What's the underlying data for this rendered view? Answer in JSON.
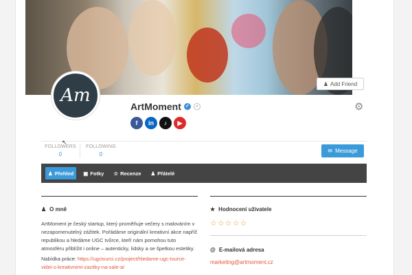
{
  "cover": {
    "add_friend_label": "Add Friend"
  },
  "profile": {
    "avatar_text": "Am",
    "name": "ArtMoment",
    "socials": [
      {
        "name": "facebook",
        "glyph": "f",
        "color": "#3b5998"
      },
      {
        "name": "linkedin",
        "glyph": "in",
        "color": "#0a66c2"
      },
      {
        "name": "tiktok",
        "glyph": "♪",
        "color": "#111111"
      },
      {
        "name": "youtube",
        "glyph": "▶",
        "color": "#e02a2a"
      }
    ]
  },
  "stats": {
    "followers_label": "FOLLOWERS",
    "followers_value": "0",
    "following_label": "FOLLOWING",
    "following_value": "0"
  },
  "actions": {
    "message_label": "Message"
  },
  "tabs": [
    {
      "label": "Přehled",
      "icon": "user-icon",
      "active": true
    },
    {
      "label": "Fotky",
      "icon": "image-icon",
      "active": false
    },
    {
      "label": "Recenze",
      "icon": "star-icon",
      "active": false
    },
    {
      "label": "Přátelé",
      "icon": "users-icon",
      "active": false
    }
  ],
  "about": {
    "title": "O mně",
    "text": "ArtMoment je český startup, který proměňuje večery s malováním v nezapomenutelný zážitek. Pořádáme originální kreativní akce napříč republikou a hledáme UGC tvůrce, kteří nám pomohou tuto atmosféru přiblížit i online – autenticky, lidsky a se špetkou estetiky.",
    "offer_label": "Nabídka práce:",
    "offer_link": "https://ugctvurci.cz/project/hledame-ugc-tvurce-videi-s-kreativnimi-zazitky-na-sale-a/"
  },
  "rating": {
    "title": "Hodnocení uživatele",
    "stars": "☆☆☆☆☆"
  },
  "email": {
    "title": "E-mailová adresa",
    "value": "marketing@artmoment.cz"
  },
  "colors": {
    "accent": "#3b9ad9",
    "link": "#e0563a",
    "tabbar": "#444444"
  }
}
